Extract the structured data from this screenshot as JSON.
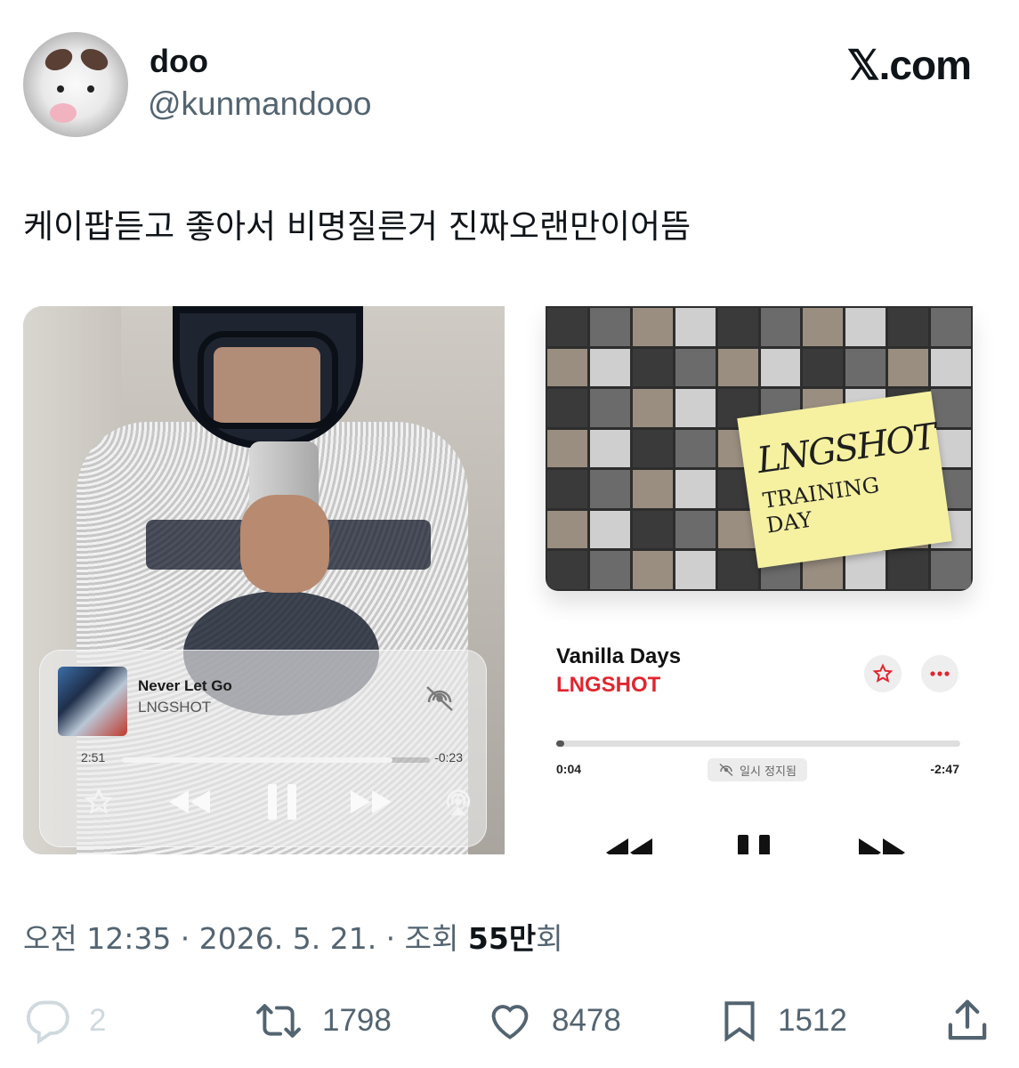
{
  "header": {
    "display_name": "doo",
    "handle": "@kunmandooo",
    "brand": "𝕏.com"
  },
  "tweet": {
    "text": "케이팝듣고 좋아서 비명질른거 진짜오랜만이어뜸"
  },
  "media": {
    "left_player": {
      "title": "Never Let Go",
      "artist": "LNGSHOT",
      "elapsed": "2:51",
      "remaining": "-0:23",
      "progress": 0.88,
      "icons": [
        "airplay-off-icon",
        "star-icon",
        "rewind-icon",
        "pause-icon",
        "fast-forward-icon",
        "airplay-icon"
      ]
    },
    "right_player": {
      "cover_text_1": "LNGSHOT",
      "cover_text_2": "TRAINING DAY",
      "title": "Vanilla Days",
      "artist": "LNGSHOT",
      "elapsed": "0:04",
      "remaining": "-2:47",
      "status": "일시 정지됨",
      "progress": 0.02,
      "accent": "#e0262f"
    }
  },
  "meta": {
    "time_date": "오전 12:35 · 2026. 5. 21. · 조회 ",
    "views": "55만",
    "views_suffix": "회"
  },
  "actions": {
    "replies": "2",
    "retweets": "1798",
    "likes": "8478",
    "bookmarks": "1512"
  }
}
